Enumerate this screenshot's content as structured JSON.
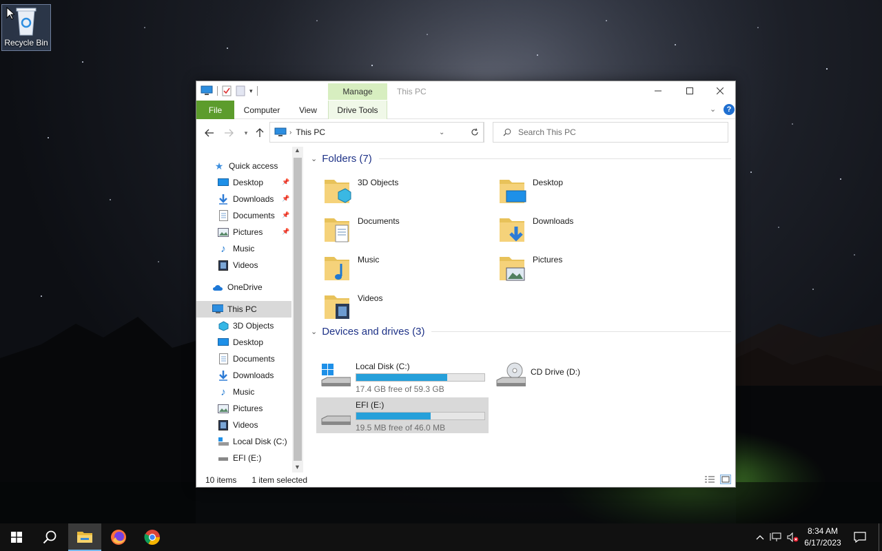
{
  "desktop": {
    "recycle_bin_label": "Recycle Bin"
  },
  "window": {
    "title": "This PC",
    "context_tab": "Manage",
    "ribbon_tabs": [
      "File",
      "Computer",
      "View",
      "Drive Tools"
    ],
    "address": {
      "path": "This PC"
    },
    "search": {
      "placeholder": "Search This PC"
    }
  },
  "nav": {
    "quick_access": "Quick access",
    "quick_items": [
      {
        "label": "Desktop",
        "pinned": true
      },
      {
        "label": "Downloads",
        "pinned": true
      },
      {
        "label": "Documents",
        "pinned": true
      },
      {
        "label": "Pictures",
        "pinned": true
      },
      {
        "label": "Music",
        "pinned": false
      },
      {
        "label": "Videos",
        "pinned": false
      }
    ],
    "onedrive": "OneDrive",
    "this_pc": "This PC",
    "pc_items": [
      "3D Objects",
      "Desktop",
      "Documents",
      "Downloads",
      "Music",
      "Pictures",
      "Videos",
      "Local Disk (C:)",
      "EFI (E:)"
    ]
  },
  "content": {
    "folders_header": "Folders (7)",
    "folders": [
      "3D Objects",
      "Desktop",
      "Documents",
      "Downloads",
      "Music",
      "Pictures",
      "Videos"
    ],
    "drives_header": "Devices and drives (3)",
    "drives": [
      {
        "name": "Local Disk (C:)",
        "free": "17.4 GB free of 59.3 GB",
        "used_fraction": 0.71
      },
      {
        "name": "CD Drive (D:)"
      },
      {
        "name": "EFI (E:)",
        "free": "19.5 MB free of 46.0 MB",
        "used_fraction": 0.58
      }
    ]
  },
  "status": {
    "items": "10 items",
    "selected": "1 item selected"
  },
  "taskbar": {
    "time": "8:34 AM",
    "date": "6/17/2023"
  },
  "colors": {
    "accent": "#26a0da",
    "file_tab": "#5c9c2c",
    "manage_tab": "#d7eec0",
    "header_text": "#1e3287"
  }
}
